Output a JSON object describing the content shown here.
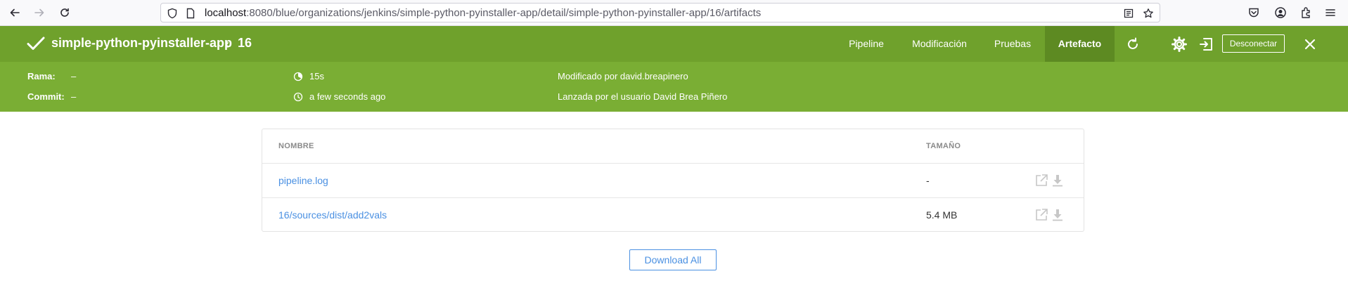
{
  "browser": {
    "url_host": "localhost",
    "url_rest": ":8080/blue/organizations/jenkins/simple-python-pyinstaller-app/detail/simple-python-pyinstaller-app/16/artifacts"
  },
  "header": {
    "pipeline_name": "simple-python-pyinstaller-app",
    "back_glyph": "‹",
    "run_number": "16",
    "tabs": [
      {
        "label": "Pipeline"
      },
      {
        "label": "Modificación"
      },
      {
        "label": "Pruebas"
      },
      {
        "label": "Artefacto"
      }
    ],
    "logout_label": "Desconectar",
    "status_color": "#6fa12c",
    "meta_color": "#7aae34"
  },
  "meta": {
    "branch_label": "Rama:",
    "branch_value": "–",
    "commit_label": "Commit:",
    "commit_value": "–",
    "duration": "15s",
    "time_ago": "a few seconds ago",
    "modified_by": "Modificado por david.breapinero",
    "launched_by": "Lanzada por el usuario David Brea Piñero"
  },
  "artifacts": {
    "columns": [
      "NOMBRE",
      "TAMAÑO"
    ],
    "rows": [
      {
        "name": "pipeline.log",
        "size": "-"
      },
      {
        "name": "16/sources/dist/add2vals",
        "size": "5.4 MB"
      }
    ],
    "download_all_label": "Download All"
  }
}
